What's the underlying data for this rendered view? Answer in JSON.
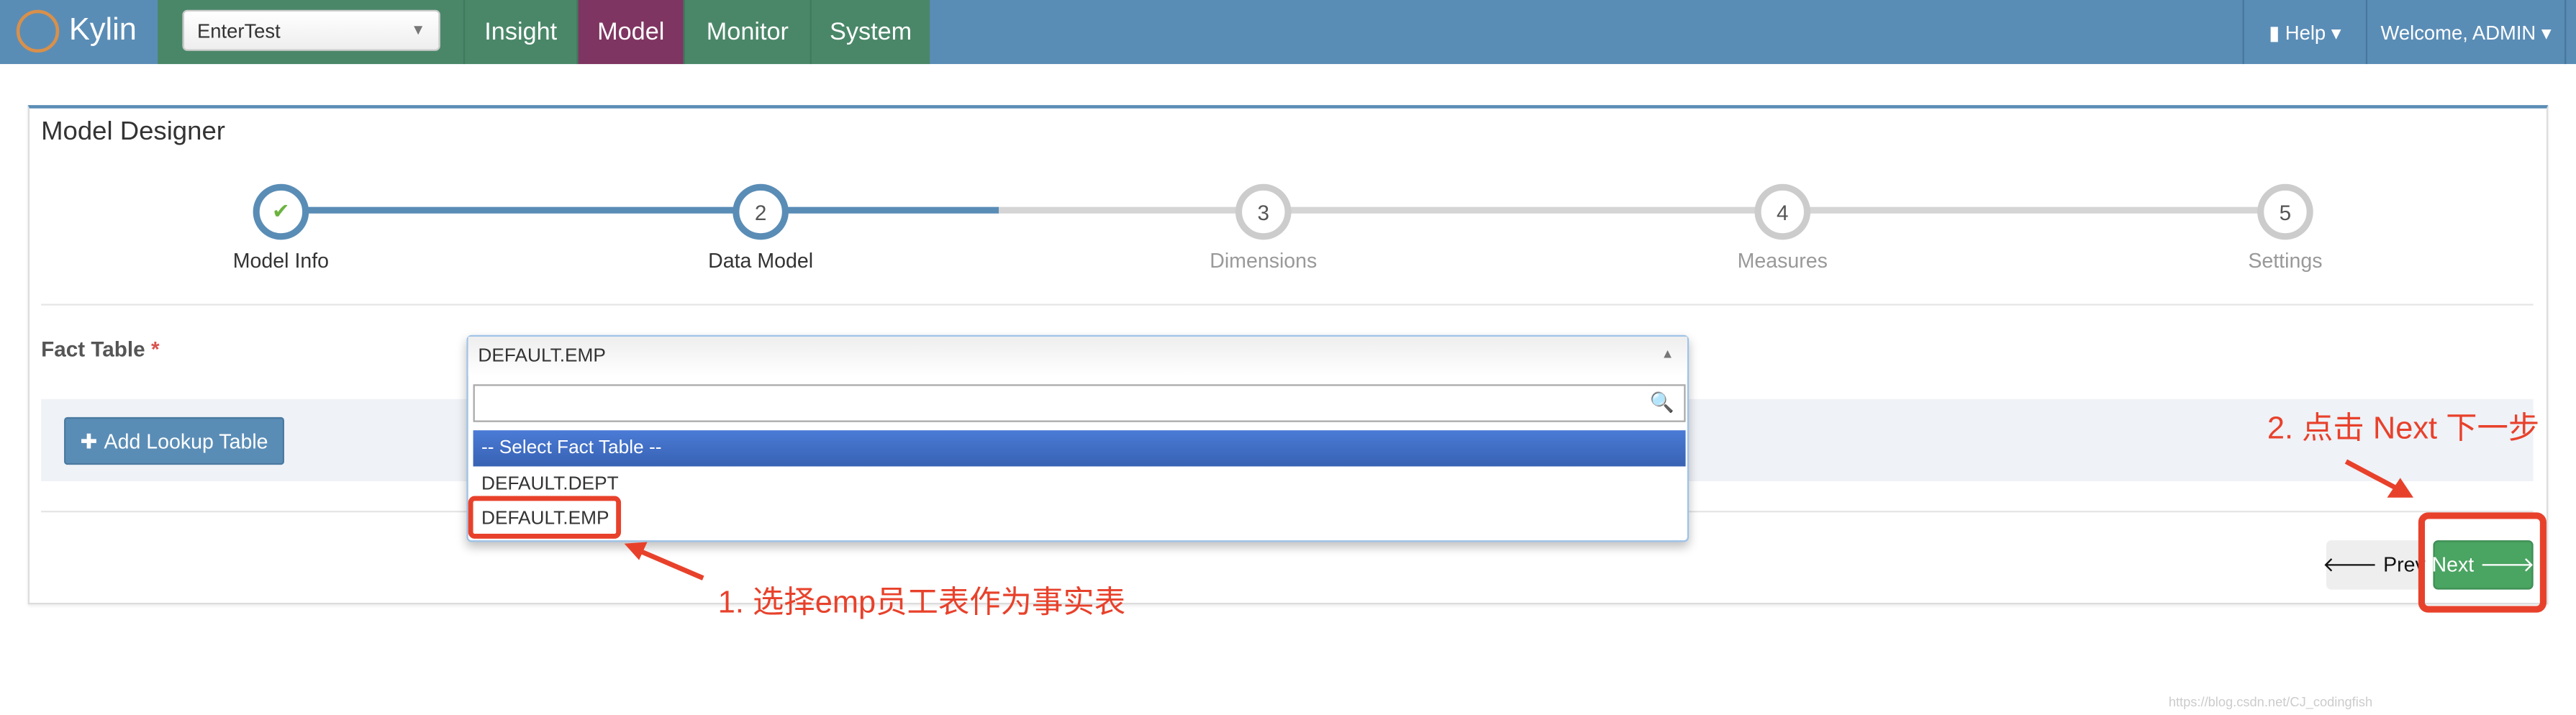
{
  "navbar": {
    "brand": "Kylin",
    "project": "EnterTest",
    "tabs": [
      {
        "label": "Insight"
      },
      {
        "label": "Model",
        "active": true
      },
      {
        "label": "Monitor"
      },
      {
        "label": "System"
      }
    ],
    "help": "Help",
    "user": "Welcome, ADMIN",
    "colors": {
      "nav": "#5a8db6",
      "tab": "#4a8768",
      "active_tab": "#7f3561"
    }
  },
  "panel": {
    "title": "Model Designer",
    "steps": [
      {
        "number": "✔",
        "label": "Model Info",
        "state": "done"
      },
      {
        "number": "2",
        "label": "Data Model",
        "state": "current"
      },
      {
        "number": "3",
        "label": "Dimensions",
        "state": "todo"
      },
      {
        "number": "4",
        "label": "Measures",
        "state": "todo"
      },
      {
        "number": "5",
        "label": "Settings",
        "state": "todo"
      }
    ],
    "fact_table_label": "Fact Table",
    "required_mark": "*",
    "fact_table": {
      "value": "DEFAULT.EMP",
      "search_value": "",
      "options": [
        "-- Select Fact Table --",
        "DEFAULT.DEPT",
        "DEFAULT.EMP"
      ],
      "highlighted": "-- Select Fact Table --"
    },
    "add_lookup_label": "Add Lookup Table",
    "prev_label": "Prev",
    "next_label": "Next"
  },
  "annotations": {
    "step1": "1. 选择emp员工表作为事实表",
    "step2": "2. 点击 Next 下一步",
    "color": "#e8412b"
  },
  "watermark": "https://blog.csdn.net/CJ_codingfish"
}
